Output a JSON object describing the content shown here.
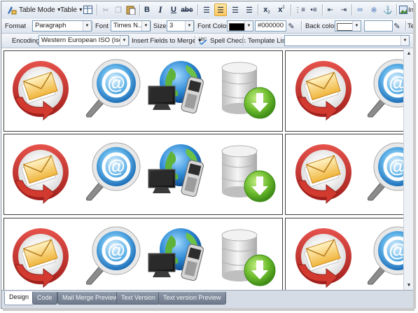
{
  "toolbar_row1": {
    "table_mode_label": "Table Mode",
    "table_label": "Table",
    "bold": "B",
    "italic": "I",
    "underline": "U",
    "strike": "abc",
    "subscript": "x",
    "superscript": "x",
    "insert_label": "In"
  },
  "toolbar_row2": {
    "format_label": "Format",
    "format_value": "Paragraph",
    "font_label": "Font",
    "font_value": "Times N...",
    "size_label": "Size",
    "size_value": "3",
    "font_color_label": "Font Color",
    "font_color_hex": "#000000",
    "font_color_swatch": "#000000",
    "back_color_label": "Back color",
    "back_color_swatch": "#ffffff",
    "back_color_value": "",
    "trailing_label": "Te"
  },
  "toolbar_row3": {
    "encoding_label": "Encoding",
    "encoding_value": "Western European ISO (iso-...",
    "insert_fields_label": "Insert Fields to Merge",
    "spell_check_label": "Spell Check",
    "template_list_label": "Template List",
    "template_list_value": ""
  },
  "grid": {
    "rows": 3,
    "icons": [
      "email-reply-icon",
      "web-search-icon",
      "network-devices-icon",
      "database-download-icon"
    ]
  },
  "tabs": [
    {
      "label": "Design",
      "active": true
    },
    {
      "label": "Code",
      "active": false
    },
    {
      "label": "Mail Merge Preview",
      "active": false
    },
    {
      "label": "Text Version",
      "active": false
    },
    {
      "label": "Text version Preview",
      "active": false
    }
  ],
  "colors": {
    "accent_active": "#ffc75a",
    "database_arrow": "#5aa92a",
    "email_ring": "#c4312f"
  }
}
